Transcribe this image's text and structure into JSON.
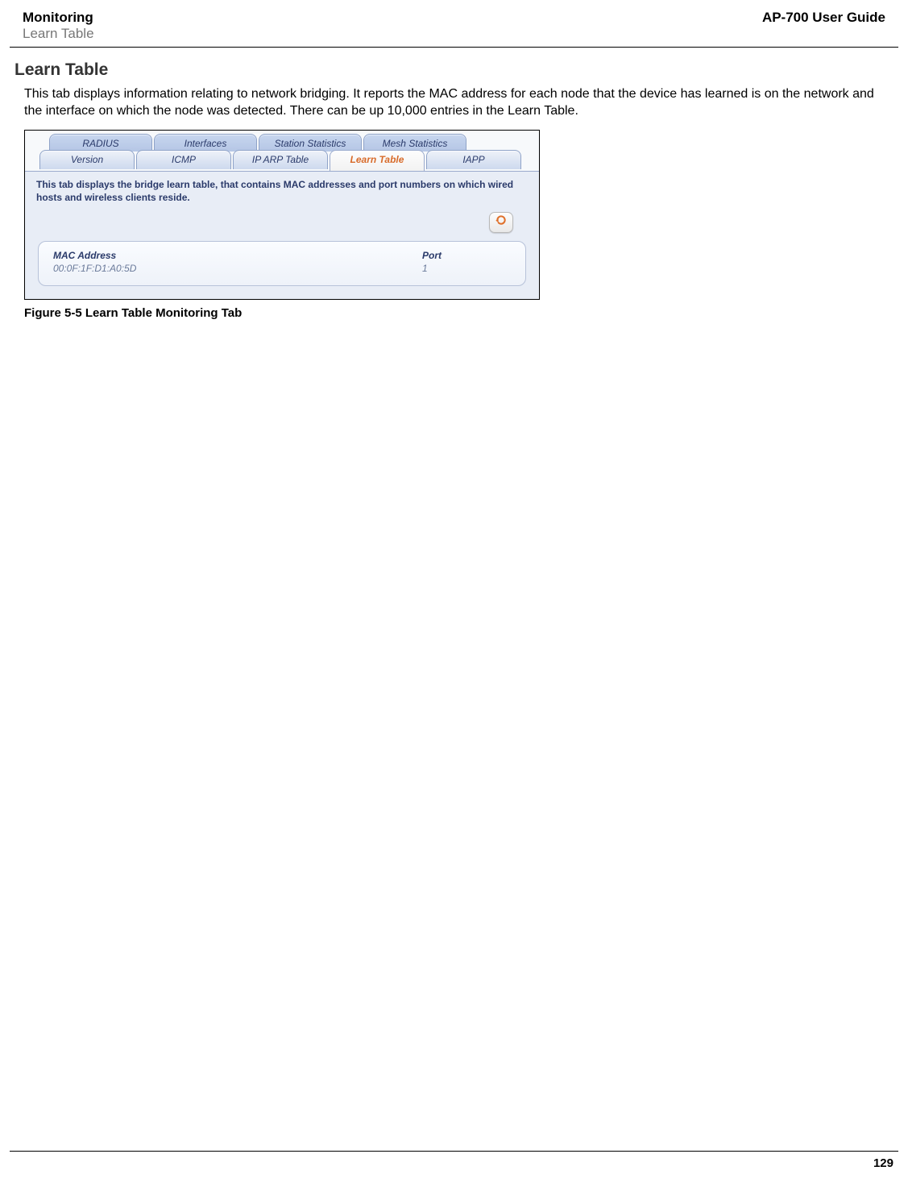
{
  "header": {
    "title": "Monitoring",
    "subtitle": "Learn Table",
    "guide": "AP-700 User Guide"
  },
  "section": {
    "heading": "Learn Table",
    "body": "This tab displays information relating to network bridging. It reports the MAC address for each node that the device has learned is on the network and the interface on which the node was detected. There can be up 10,000 entries in the Learn Table."
  },
  "screenshot": {
    "tabs_back": [
      "RADIUS",
      "Interfaces",
      "Station Statistics",
      "Mesh Statistics"
    ],
    "tabs_front": [
      "Version",
      "ICMP",
      "IP ARP Table",
      "Learn Table",
      "IAPP"
    ],
    "active_tab": "Learn Table",
    "blurb": "This tab displays the bridge learn table, that contains MAC addresses and port numbers on which wired hosts and wireless clients reside.",
    "refresh_icon": "refresh-icon",
    "table": {
      "headers": {
        "mac": "MAC Address",
        "port": "Port"
      },
      "rows": [
        {
          "mac": "00:0F:1F:D1:A0:5D",
          "port": "1"
        }
      ]
    }
  },
  "figure_caption": "Figure 5-5 Learn Table Monitoring Tab",
  "footer": {
    "page_number": "129"
  }
}
